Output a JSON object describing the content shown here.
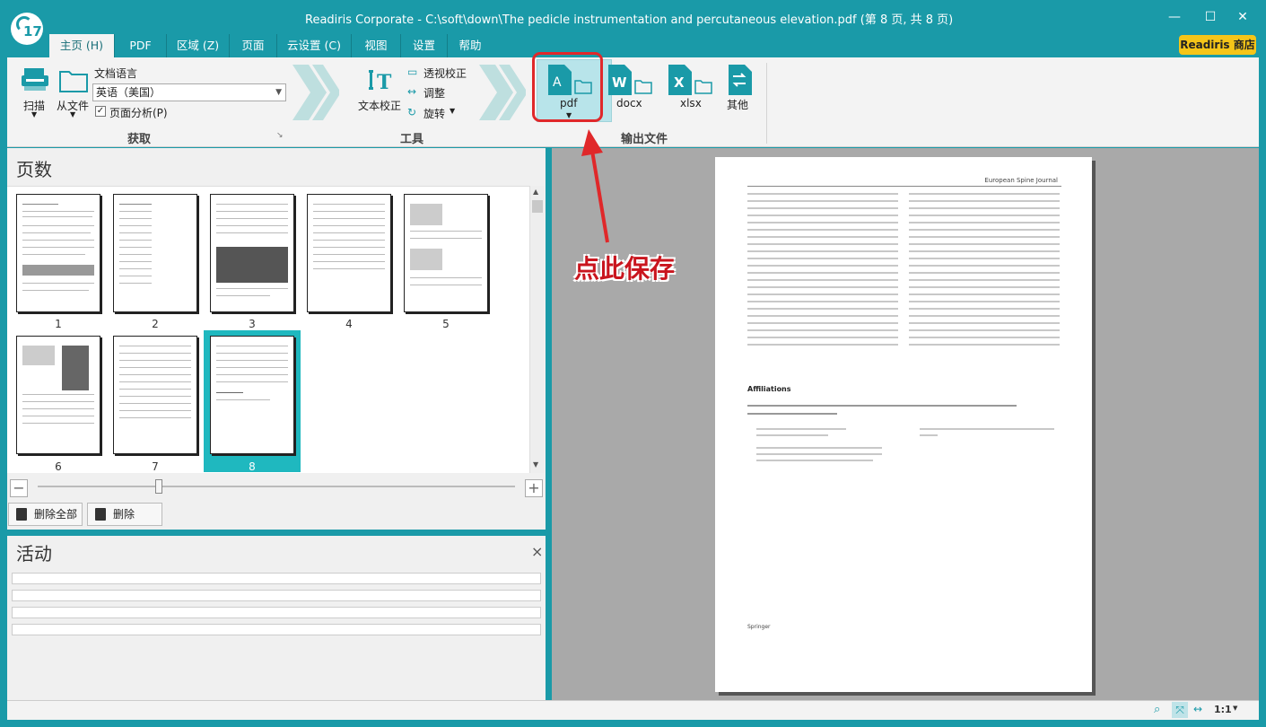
{
  "app": {
    "logo_text": "17",
    "title": "Readiris Corporate - C:\\soft\\down\\The pedicle instrumentation and percutaneous elevation.pdf (第 8 页, 共 8 页)"
  },
  "window": {
    "minimize": "—",
    "maximize": "☐",
    "close": "✕"
  },
  "tabs": [
    "主页 (H)",
    "PDF",
    "区域 (Z)",
    "页面",
    "云设置 (C)",
    "视图",
    "设置",
    "帮助"
  ],
  "store_button": "Readiris 商店",
  "ribbon": {
    "scan": "扫描",
    "from_file": "从文件",
    "doc_lang_label": "文档语言",
    "doc_lang_value": "英语（美国）",
    "page_analysis": "页面分析(P)",
    "acquire_group": "获取",
    "text_correct": "文本校正",
    "perspective": "透视校正",
    "adjust": "调整",
    "rotate": "旋转",
    "tools_group": "工具",
    "out_pdf": "pdf",
    "out_docx": "docx",
    "out_xlsx": "xlsx",
    "out_other": "其他",
    "output_group": "输出文件"
  },
  "pages_pane": {
    "title": "页数",
    "thumbs": [
      "1",
      "2",
      "3",
      "4",
      "5",
      "6",
      "7",
      "8"
    ],
    "delete_all": "删除全部",
    "delete": "删除"
  },
  "activity_pane": {
    "title": "活动",
    "close": "×"
  },
  "document": {
    "header": "European Spine Journal",
    "affiliations": "Affiliations",
    "publisher": "Springer"
  },
  "annotation": "点此保存",
  "status": {
    "zoom_ratio": "1:1"
  },
  "colors": {
    "accent": "#1a9aa8",
    "store": "#f5c518",
    "annotation": "#e0282a"
  }
}
